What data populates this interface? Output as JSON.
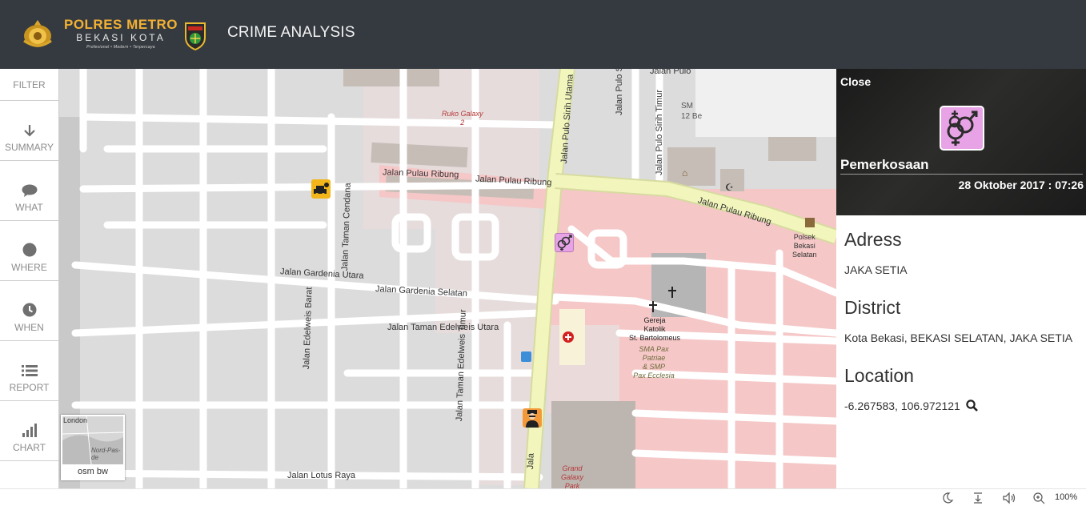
{
  "header": {
    "brand_line1": "POLRES METRO",
    "brand_line2": "BEKASI KOTA",
    "brand_tagline": "Profesional • Modern • Terpercaya",
    "app_title": "CRIME ANALYSIS"
  },
  "sidebar": {
    "items": [
      {
        "label": "FILTER",
        "icon": "none"
      },
      {
        "label": "SUMMARY",
        "icon": "download-arrow-icon"
      },
      {
        "label": "WHAT",
        "icon": "chat-bubble-icon"
      },
      {
        "label": "WHERE",
        "icon": "circle-icon"
      },
      {
        "label": "WHEN",
        "icon": "clock-icon"
      },
      {
        "label": "REPORT",
        "icon": "list-icon"
      },
      {
        "label": "CHART",
        "icon": "signal-bars-icon"
      }
    ]
  },
  "map": {
    "streets": {
      "pulau_ribung_1": "Jalan Pulau Ribung",
      "pulau_ribung_2": "Jalan Pulau Ribung",
      "pulau_ribung_3": "Jalan Pulau Ribung",
      "gardenia_utara": "Jalan Gardenia Utara",
      "gardenia_selatan": "Jalan Gardenia Selatan",
      "edelweis_utara": "Jalan Taman Edelweis Utara",
      "edelweis_barat": "Jalan Edelweis Barat",
      "edelweis_timur": "Jalan Taman Edelweis Timur",
      "taman_cendana": "Jalan Taman Cendana",
      "pulo_sirih_utama": "Jalan Pulo Sirih Utama",
      "pulo_sirih_1": "Jalan Pulo S",
      "pulo_sirih_timur": "Jalan Pulo Sirih Timur",
      "pulo_top": "Jalan Pulo",
      "lotus_raya": "Jalan Lotus Raya",
      "jala_bottom": "Jala"
    },
    "pois": {
      "ruko_galaxy": "Ruko Galaxy",
      "ruko_galaxy_2": "2",
      "smp_12_a": "SM",
      "smp_12_b": "12 Be",
      "polsek_1": "Polsek",
      "polsek_2": "Bekasi",
      "polsek_3": "Selatan",
      "gereja_1": "Gereja",
      "gereja_2": "Katolik",
      "gereja_3": "St. Bartolomeus",
      "sma_1": "SMA Pax",
      "sma_2": "Patriae",
      "sma_3": "& SMP",
      "sma_4": "Pax Ecclesia",
      "grand_galaxy_1": "Grand",
      "grand_galaxy_2": "Galaxy",
      "grand_galaxy_3": "Park"
    },
    "minimap": {
      "label": "osm bw",
      "place_1": "London",
      "place_2": "Nord-Pas-de"
    },
    "colors": {
      "base": "#dcdcdc",
      "road": "#ffffff",
      "primary_road": "#f3f7c0",
      "landuse_pink": "#f5c7c7",
      "building": "#c4b8b0"
    }
  },
  "detail": {
    "close_label": "Close",
    "crime_icon": "gender-symbols-icon",
    "crime_type": "Pemerkosaan",
    "datetime": "28 Oktober 2017 : 07:26",
    "address_heading": "Adress",
    "address_value": "JAKA SETIA",
    "district_heading": "District",
    "district_value": "Kota Bekasi, BEKASI SELATAN, JAKA SETIA",
    "location_heading": "Location",
    "location_value": "-6.267583, 106.972121",
    "location_action_icon": "search-icon"
  },
  "statusbar": {
    "zoom": "100%",
    "icons": [
      "moon-icon",
      "download-tray-icon",
      "speaker-icon",
      "zoom-in-icon"
    ]
  }
}
